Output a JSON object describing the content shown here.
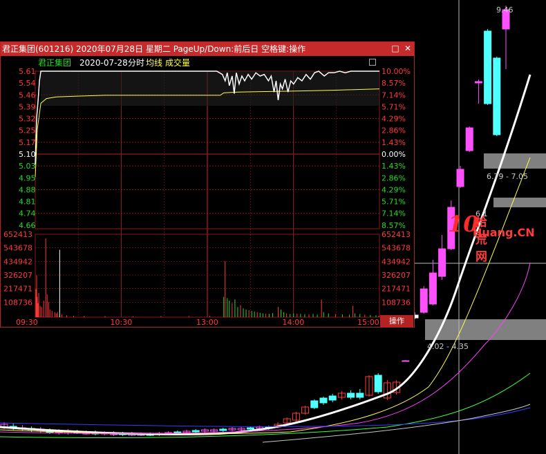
{
  "kline": {
    "price_label_high": "9.46",
    "range_label_1": "6.79 - 7.05",
    "range_label_2": "4.02 - 4.35",
    "partial_label": "6.1",
    "watermark": {
      "big": "10",
      "cn": "拾荒网",
      "url": "Huang.CN"
    }
  },
  "popup": {
    "title": "君正集团(601216) 2020年07月28日  星期二  PageUp/Down:前后日  空格键:操作",
    "subheader": {
      "name": "君正集团",
      "date": "2020-07-28",
      "mode": "分时",
      "avg_label": "均线",
      "vol_label": "成交量"
    },
    "operate_button": "操作",
    "colors": {
      "title_bg": "#c62a2a",
      "up": "#ff3a3a",
      "down": "#26d926",
      "flat": "#ffffff",
      "price_line": "#ffffff",
      "avg_line": "#ffff4a",
      "grid": "#8b1a1a"
    }
  },
  "chart_data": {
    "type": "line",
    "title": "",
    "price_ticks": [
      "5.61",
      "5.54",
      "5.46",
      "5.39",
      "5.32",
      "5.25",
      "5.17",
      "5.10",
      "5.03",
      "4.95",
      "4.88",
      "4.81",
      "4.74",
      "4.66"
    ],
    "pct_ticks": [
      "10.00%",
      "8.57%",
      "7.14%",
      "5.71%",
      "4.29%",
      "2.86%",
      "1.43%",
      "0.00%",
      "1.43%",
      "2.86%",
      "4.29%",
      "5.71%",
      "7.14%",
      "8.57%"
    ],
    "volume_ticks": [
      "652413",
      "543678",
      "434942",
      "326207",
      "217471",
      "108736"
    ],
    "time_ticks": [
      "09:30",
      "10:30",
      "13:00",
      "14:00",
      "15:00"
    ],
    "prev_close": 5.1,
    "ylim": [
      4.63,
      5.61
    ],
    "vol_max": 652413,
    "price_series": [
      [
        0,
        5.03
      ],
      [
        2,
        5.32
      ],
      [
        4,
        5.42
      ],
      [
        6,
        5.55
      ],
      [
        8,
        5.61
      ],
      [
        30,
        5.61
      ],
      [
        60,
        5.61
      ],
      [
        100,
        5.61
      ],
      [
        140,
        5.61
      ],
      [
        180,
        5.61
      ],
      [
        220,
        5.61
      ],
      [
        260,
        5.61
      ],
      [
        268,
        5.59
      ],
      [
        272,
        5.55
      ],
      [
        275,
        5.6
      ],
      [
        278,
        5.52
      ],
      [
        282,
        5.58
      ],
      [
        285,
        5.47
      ],
      [
        288,
        5.6
      ],
      [
        292,
        5.53
      ],
      [
        296,
        5.58
      ],
      [
        300,
        5.55
      ],
      [
        305,
        5.59
      ],
      [
        310,
        5.56
      ],
      [
        316,
        5.6
      ],
      [
        322,
        5.58
      ],
      [
        328,
        5.59
      ],
      [
        334,
        5.55
      ],
      [
        338,
        5.58
      ],
      [
        342,
        5.48
      ],
      [
        345,
        5.55
      ],
      [
        348,
        5.43
      ],
      [
        351,
        5.53
      ],
      [
        354,
        5.5
      ],
      [
        358,
        5.56
      ],
      [
        362,
        5.48
      ],
      [
        366,
        5.55
      ],
      [
        370,
        5.53
      ],
      [
        376,
        5.57
      ],
      [
        382,
        5.55
      ],
      [
        388,
        5.59
      ],
      [
        394,
        5.56
      ],
      [
        400,
        5.6
      ],
      [
        406,
        5.61
      ],
      [
        414,
        5.58
      ],
      [
        420,
        5.6
      ],
      [
        428,
        5.6
      ],
      [
        436,
        5.61
      ],
      [
        444,
        5.6
      ],
      [
        452,
        5.61
      ],
      [
        470,
        5.61
      ],
      [
        480,
        5.61
      ],
      [
        493,
        5.61
      ]
    ],
    "avg_series": [
      [
        0,
        4.95
      ],
      [
        3,
        5.25
      ],
      [
        8,
        5.41
      ],
      [
        16,
        5.44
      ],
      [
        30,
        5.45
      ],
      [
        60,
        5.455
      ],
      [
        100,
        5.46
      ],
      [
        140,
        5.46
      ],
      [
        200,
        5.46
      ],
      [
        265,
        5.46
      ],
      [
        270,
        5.475
      ],
      [
        290,
        5.48
      ],
      [
        330,
        5.483
      ],
      [
        380,
        5.487
      ],
      [
        430,
        5.492
      ],
      [
        493,
        5.5
      ]
    ],
    "volumes": [
      [
        1,
        220000
      ],
      [
        2,
        330000
      ],
      [
        3,
        160000
      ],
      [
        4,
        110000
      ],
      [
        5,
        190000
      ],
      [
        7,
        90000
      ],
      [
        9,
        80000
      ],
      [
        12,
        130000
      ],
      [
        15,
        620000
      ],
      [
        17,
        180000
      ],
      [
        19,
        120000
      ],
      [
        21,
        60000
      ],
      [
        24,
        50000
      ],
      [
        28,
        40000
      ],
      [
        30,
        30000
      ],
      [
        32,
        40000
      ],
      [
        35,
        530000
      ],
      [
        38,
        20000
      ],
      [
        45,
        15000
      ],
      [
        55,
        12000
      ],
      [
        70,
        10000
      ],
      [
        100,
        9000
      ],
      [
        140,
        8000
      ],
      [
        180,
        9000
      ],
      [
        220,
        8000
      ],
      [
        250,
        10000
      ],
      [
        270,
        160000
      ],
      [
        272,
        440000
      ],
      [
        275,
        150000
      ],
      [
        278,
        130000
      ],
      [
        282,
        110000
      ],
      [
        286,
        140000
      ],
      [
        290,
        80000
      ],
      [
        294,
        95000
      ],
      [
        298,
        70000
      ],
      [
        302,
        60000
      ],
      [
        306,
        55000
      ],
      [
        310,
        50000
      ],
      [
        314,
        45000
      ],
      [
        318,
        40000
      ],
      [
        322,
        35000
      ],
      [
        326,
        30000
      ],
      [
        330,
        28000
      ],
      [
        335,
        26000
      ],
      [
        340,
        32000
      ],
      [
        348,
        80000
      ],
      [
        352,
        60000
      ],
      [
        356,
        40000
      ],
      [
        360,
        30000
      ],
      [
        365,
        25000
      ],
      [
        370,
        30000
      ],
      [
        375,
        28000
      ],
      [
        380,
        26000
      ],
      [
        386,
        24000
      ],
      [
        392,
        22000
      ],
      [
        398,
        25000
      ],
      [
        404,
        20000
      ],
      [
        410,
        140000
      ],
      [
        413,
        40000
      ],
      [
        420,
        30000
      ],
      [
        430,
        26000
      ],
      [
        440,
        22000
      ],
      [
        450,
        20000
      ],
      [
        455,
        90000
      ],
      [
        458,
        30000
      ],
      [
        465,
        25000
      ],
      [
        472,
        20000
      ],
      [
        480,
        18000
      ],
      [
        488,
        15000
      ],
      [
        492,
        12000
      ]
    ],
    "volume_colors_note": "",
    "kline_candles": [
      [
        0,
        614,
        619,
        611,
        621,
        "up"
      ],
      [
        1,
        617,
        619,
        612,
        623,
        "down"
      ],
      [
        2,
        619,
        621,
        615,
        624,
        "up"
      ],
      [
        3,
        620,
        622,
        617,
        625,
        "down"
      ],
      [
        4,
        621,
        624,
        618,
        627,
        "up"
      ],
      [
        5,
        623,
        626,
        620,
        628,
        "down"
      ],
      [
        6,
        624,
        626,
        621,
        629,
        "up"
      ],
      [
        7,
        624,
        627,
        621,
        629,
        "up"
      ],
      [
        8,
        624,
        626,
        622,
        628,
        "down"
      ],
      [
        9,
        625,
        628,
        623,
        629,
        "up"
      ],
      [
        10,
        626,
        628,
        623,
        630,
        "down"
      ],
      [
        11,
        626,
        628,
        624,
        630,
        "up"
      ],
      [
        12,
        627,
        629,
        624,
        631,
        "up"
      ],
      [
        13,
        627,
        629,
        625,
        631,
        "down"
      ],
      [
        14,
        627,
        630,
        625,
        631,
        "up"
      ],
      [
        15,
        628,
        630,
        626,
        631,
        "up"
      ],
      [
        16,
        628,
        630,
        626,
        631,
        "down"
      ],
      [
        17,
        627,
        629,
        625,
        631,
        "up"
      ],
      [
        18,
        626,
        628,
        624,
        630,
        "up"
      ],
      [
        19,
        625,
        627,
        623,
        629,
        "down"
      ],
      [
        20,
        624,
        626,
        622,
        628,
        "up"
      ],
      [
        21,
        623,
        625,
        621,
        627,
        "down"
      ],
      [
        22,
        622,
        624,
        620,
        626,
        "up"
      ],
      [
        23,
        622,
        624,
        620,
        626,
        "up"
      ],
      [
        24,
        621,
        623,
        619,
        625,
        "down"
      ],
      [
        25,
        620,
        622,
        618,
        624,
        "up"
      ],
      [
        26,
        620,
        622,
        618,
        624,
        "up"
      ],
      [
        27,
        619,
        621,
        617,
        623,
        "down"
      ],
      [
        28,
        618,
        620,
        616,
        622,
        "up"
      ],
      [
        29,
        618,
        620,
        616,
        622,
        "down"
      ],
      [
        30,
        614,
        618,
        611,
        620,
        "up"
      ],
      [
        31,
        606,
        612,
        604,
        614,
        "up"
      ],
      [
        32,
        598,
        608,
        596,
        610,
        "up"
      ],
      [
        33,
        589,
        598,
        587,
        600,
        "up"
      ],
      [
        34,
        580,
        590,
        578,
        592,
        "down"
      ],
      [
        35,
        576,
        583,
        574,
        586,
        "down"
      ],
      [
        36,
        573,
        579,
        570,
        582,
        "down"
      ],
      [
        37,
        569,
        575,
        566,
        578,
        "up"
      ],
      [
        38,
        569,
        575,
        565,
        578,
        "down"
      ],
      [
        39,
        569,
        575,
        563,
        578,
        "down"
      ],
      [
        40,
        545,
        572,
        543,
        574,
        "up"
      ],
      [
        41,
        543,
        567,
        540,
        570,
        "down"
      ],
      [
        42,
        554,
        576,
        550,
        579,
        "up"
      ],
      [
        43,
        553,
        568,
        550,
        571,
        "up"
      ],
      [
        44,
        522,
        522,
        521,
        522,
        "up"
      ],
      [
        45,
        456,
        460,
        452,
        462,
        "flat"
      ],
      [
        46,
        418,
        452,
        414,
        454,
        "up"
      ],
      [
        47,
        395,
        440,
        376,
        442,
        "up"
      ],
      [
        48,
        360,
        400,
        340,
        405,
        "up"
      ],
      [
        49,
        300,
        360,
        290,
        362,
        "up"
      ],
      [
        50,
        245,
        270,
        240,
        272,
        "up"
      ],
      [
        51,
        185,
        218,
        183,
        220,
        "up"
      ],
      [
        52,
        118,
        120,
        115,
        150,
        "up"
      ],
      [
        53,
        45,
        150,
        42,
        152,
        "down"
      ],
      [
        54,
        84,
        195,
        82,
        197,
        "down"
      ],
      [
        55,
        14,
        42,
        8,
        100,
        "up"
      ]
    ]
  }
}
